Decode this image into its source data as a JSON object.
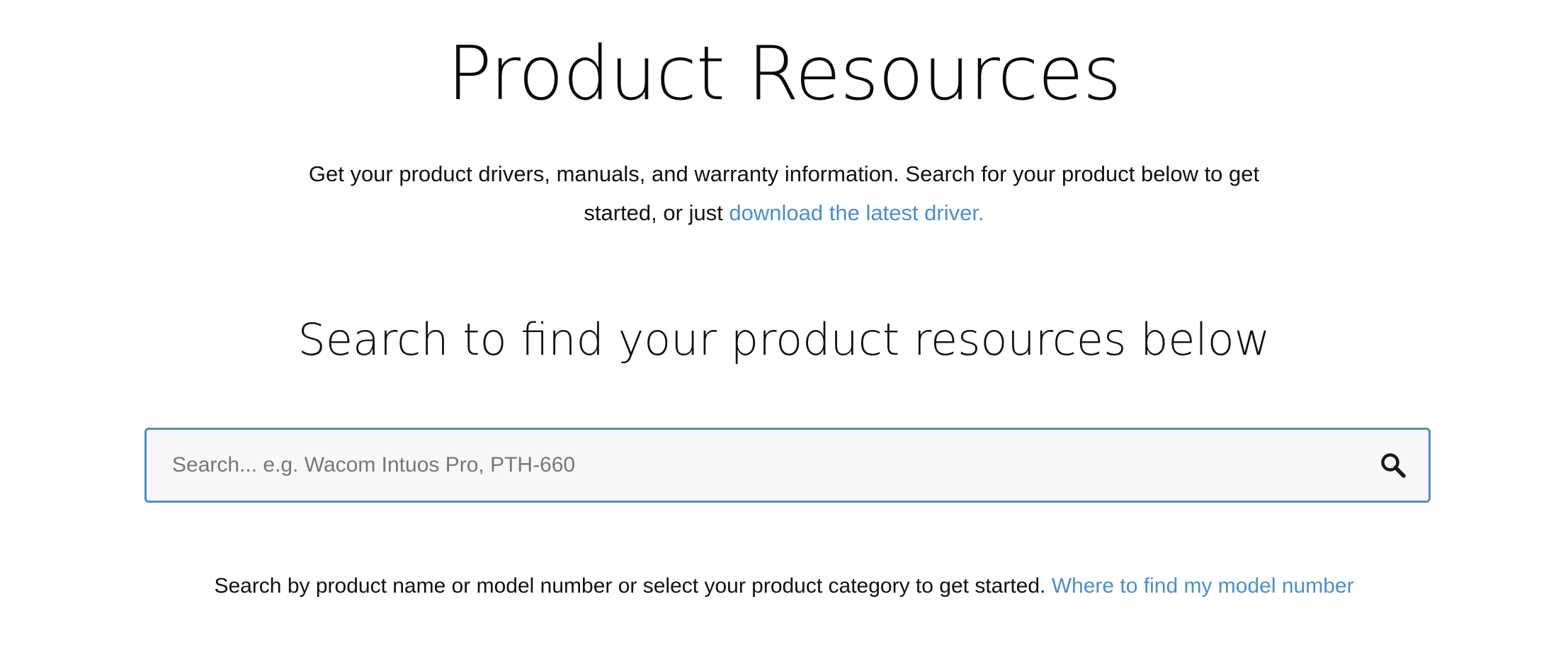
{
  "page": {
    "title": "Product Resources"
  },
  "intro": {
    "text": "Get your product drivers, manuals, and warranty information. Search for your product below to get started, or just ",
    "link_label": "download the latest driver."
  },
  "search": {
    "heading": "Search to find your product resources below",
    "placeholder": "Search... e.g. Wacom Intuos Pro, PTH-660",
    "value": "",
    "button_icon": "search-icon"
  },
  "help": {
    "text": "Search by product name or model number or select your product category to get started. ",
    "link_label": "Where to find my model number"
  },
  "colors": {
    "accent": "#4a8fcb",
    "text": "#111111",
    "input_background": "#f8f8f8"
  }
}
